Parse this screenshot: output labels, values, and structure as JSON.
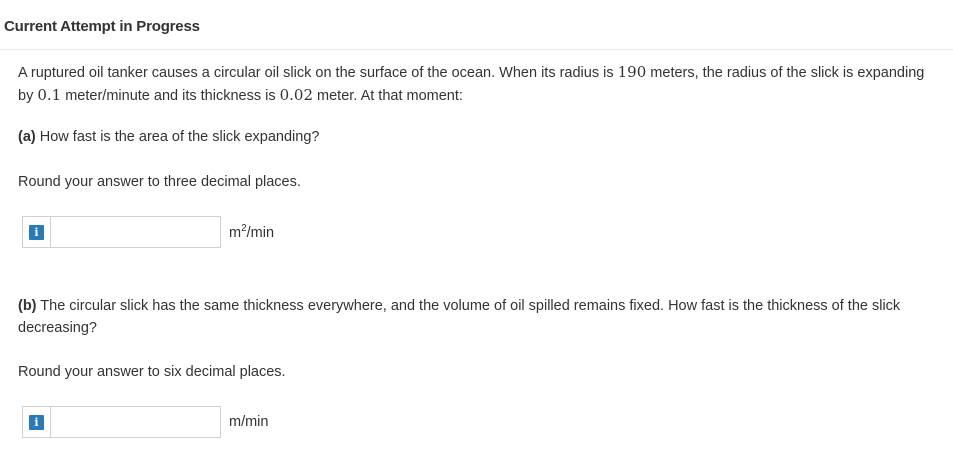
{
  "header": {
    "title": "Current Attempt in Progress"
  },
  "question": {
    "text_1": "A ruptured oil tanker causes a circular oil slick on the surface of the ocean. When its radius is ",
    "radius_value": "190",
    "text_2": " meters, the radius of the slick is expanding by ",
    "rate_value": "0.1",
    "text_3": " meter/minute and its thickness is ",
    "thickness_value": "0.02",
    "text_4": " meter. At that moment:"
  },
  "part_a": {
    "label": "(a)",
    "question": " How fast is the area of the slick expanding?",
    "round_instruction": "Round your answer to three decimal places.",
    "input_value": "",
    "unit_base": "m",
    "unit_exp": "2",
    "unit_suffix": "/min",
    "info_icon": "info-icon"
  },
  "part_b": {
    "label": "(b)",
    "question": " The circular slick has the same thickness everywhere, and the volume of oil spilled remains fixed. How fast is the thickness of the slick decreasing?",
    "round_instruction": "Round your answer to six decimal places.",
    "input_value": "",
    "unit": "m/min",
    "info_icon": "info-icon"
  },
  "colors": {
    "info_icon_bg": "#2a7ab8",
    "text": "#333333",
    "border": "#d0d0d0"
  }
}
